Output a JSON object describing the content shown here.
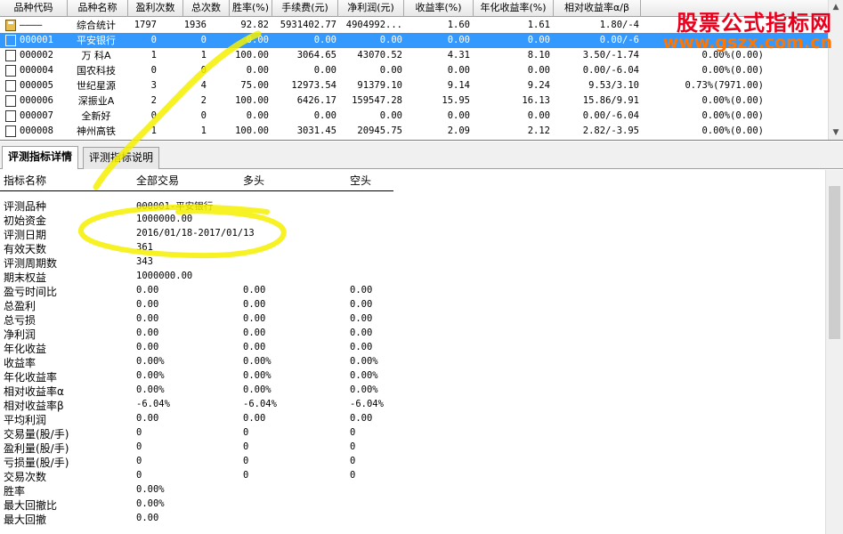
{
  "grid": {
    "headers": [
      "品种代码",
      "品种名称",
      "盈利次数",
      "总次数",
      "胜率(%)",
      "手续费(元)",
      "净利润(元)",
      "收益率(%)",
      "年化收益率(%)",
      "相对收益率α/β"
    ],
    "rows": [
      {
        "code": "————",
        "name": "综合统计",
        "win": "1797",
        "total": "1936",
        "rate": "92.82",
        "fee": "5931402.77",
        "profit": "4904992...",
        "ret": "1.60",
        "annual": "1.61",
        "rel": "1.80/-4",
        "extra": ""
      },
      {
        "code": "000001",
        "name": "平安银行",
        "win": "0",
        "total": "0",
        "rate": "0.00",
        "fee": "0.00",
        "profit": "0.00",
        "ret": "0.00",
        "annual": "0.00",
        "rel": "0.00/-6",
        "extra": ""
      },
      {
        "code": "000002",
        "name": "万 科A",
        "win": "1",
        "total": "1",
        "rate": "100.00",
        "fee": "3064.65",
        "profit": "43070.52",
        "ret": "4.31",
        "annual": "8.10",
        "rel": "3.50/-1.74",
        "extra": "0.00%(0.00)"
      },
      {
        "code": "000004",
        "name": "国农科技",
        "win": "0",
        "total": "0",
        "rate": "0.00",
        "fee": "0.00",
        "profit": "0.00",
        "ret": "0.00",
        "annual": "0.00",
        "rel": "0.00/-6.04",
        "extra": "0.00%(0.00)"
      },
      {
        "code": "000005",
        "name": "世纪星源",
        "win": "3",
        "total": "4",
        "rate": "75.00",
        "fee": "12973.54",
        "profit": "91379.10",
        "ret": "9.14",
        "annual": "9.24",
        "rel": "9.53/3.10",
        "extra": "0.73%(7971.00)"
      },
      {
        "code": "000006",
        "name": "深振业A",
        "win": "2",
        "total": "2",
        "rate": "100.00",
        "fee": "6426.17",
        "profit": "159547.28",
        "ret": "15.95",
        "annual": "16.13",
        "rel": "15.86/9.91",
        "extra": "0.00%(0.00)"
      },
      {
        "code": "000007",
        "name": "全新好",
        "win": "0",
        "total": "0",
        "rate": "0.00",
        "fee": "0.00",
        "profit": "0.00",
        "ret": "0.00",
        "annual": "0.00",
        "rel": "0.00/-6.04",
        "extra": "0.00%(0.00)"
      },
      {
        "code": "000008",
        "name": "神州高铁",
        "win": "1",
        "total": "1",
        "rate": "100.00",
        "fee": "3031.45",
        "profit": "20945.75",
        "ret": "2.09",
        "annual": "2.12",
        "rel": "2.82/-3.95",
        "extra": "0.00%(0.00)"
      }
    ]
  },
  "tabs": [
    "评测指标详情",
    "评测指标说明"
  ],
  "detail": {
    "headers": [
      "指标名称",
      "全部交易",
      "多头",
      "空头"
    ],
    "rows": [
      {
        "label": "评测品种",
        "all": "000001-平安银行",
        "long": "",
        "short": ""
      },
      {
        "label": "初始资金",
        "all": "1000000.00",
        "long": "",
        "short": ""
      },
      {
        "label": "评测日期",
        "all": "2016/01/18-2017/01/13",
        "long": "",
        "short": ""
      },
      {
        "label": "有效天数",
        "all": "361",
        "long": "",
        "short": ""
      },
      {
        "label": "评测周期数",
        "all": "343",
        "long": "",
        "short": ""
      },
      {
        "label": "期末权益",
        "all": "1000000.00",
        "long": "",
        "short": ""
      },
      {
        "label": "盈亏时间比",
        "all": "0.00",
        "long": "0.00",
        "short": "0.00"
      },
      {
        "label": "总盈利",
        "all": "0.00",
        "long": "0.00",
        "short": "0.00"
      },
      {
        "label": "总亏损",
        "all": "0.00",
        "long": "0.00",
        "short": "0.00"
      },
      {
        "label": "净利润",
        "all": "0.00",
        "long": "0.00",
        "short": "0.00"
      },
      {
        "label": "年化收益",
        "all": "0.00",
        "long": "0.00",
        "short": "0.00"
      },
      {
        "label": "收益率",
        "all": "0.00%",
        "long": "0.00%",
        "short": "0.00%"
      },
      {
        "label": "年化收益率",
        "all": "0.00%",
        "long": "0.00%",
        "short": "0.00%"
      },
      {
        "label": "相对收益率α",
        "all": "0.00%",
        "long": "0.00%",
        "short": "0.00%"
      },
      {
        "label": "相对收益率β",
        "all": "-6.04%",
        "long": "-6.04%",
        "short": "-6.04%"
      },
      {
        "label": "平均利润",
        "all": "0.00",
        "long": "0.00",
        "short": "0.00"
      },
      {
        "label": "交易量(股/手)",
        "all": "0",
        "long": "0",
        "short": "0"
      },
      {
        "label": "盈利量(股/手)",
        "all": "0",
        "long": "0",
        "short": "0"
      },
      {
        "label": "亏损量(股/手)",
        "all": "0",
        "long": "0",
        "short": "0"
      },
      {
        "label": "交易次数",
        "all": "0",
        "long": "0",
        "short": "0"
      },
      {
        "label": "胜率",
        "all": "0.00%",
        "long": "",
        "short": ""
      },
      {
        "label": "最大回撤比",
        "all": "0.00%",
        "long": "",
        "short": ""
      },
      {
        "label": "最大回撤",
        "all": "0.00",
        "long": "",
        "short": ""
      }
    ]
  },
  "watermark": {
    "title": "股票公式指标网",
    "url": "www.gszx.com.cn"
  },
  "colors": {
    "selection": "#3399ff",
    "watermark": "#e8001c",
    "annotation": "#f5f000"
  },
  "icons": {
    "summary": "folder-summary-icon",
    "stock": "document-icon",
    "scroll_up": "▲",
    "scroll_down": "▼"
  }
}
